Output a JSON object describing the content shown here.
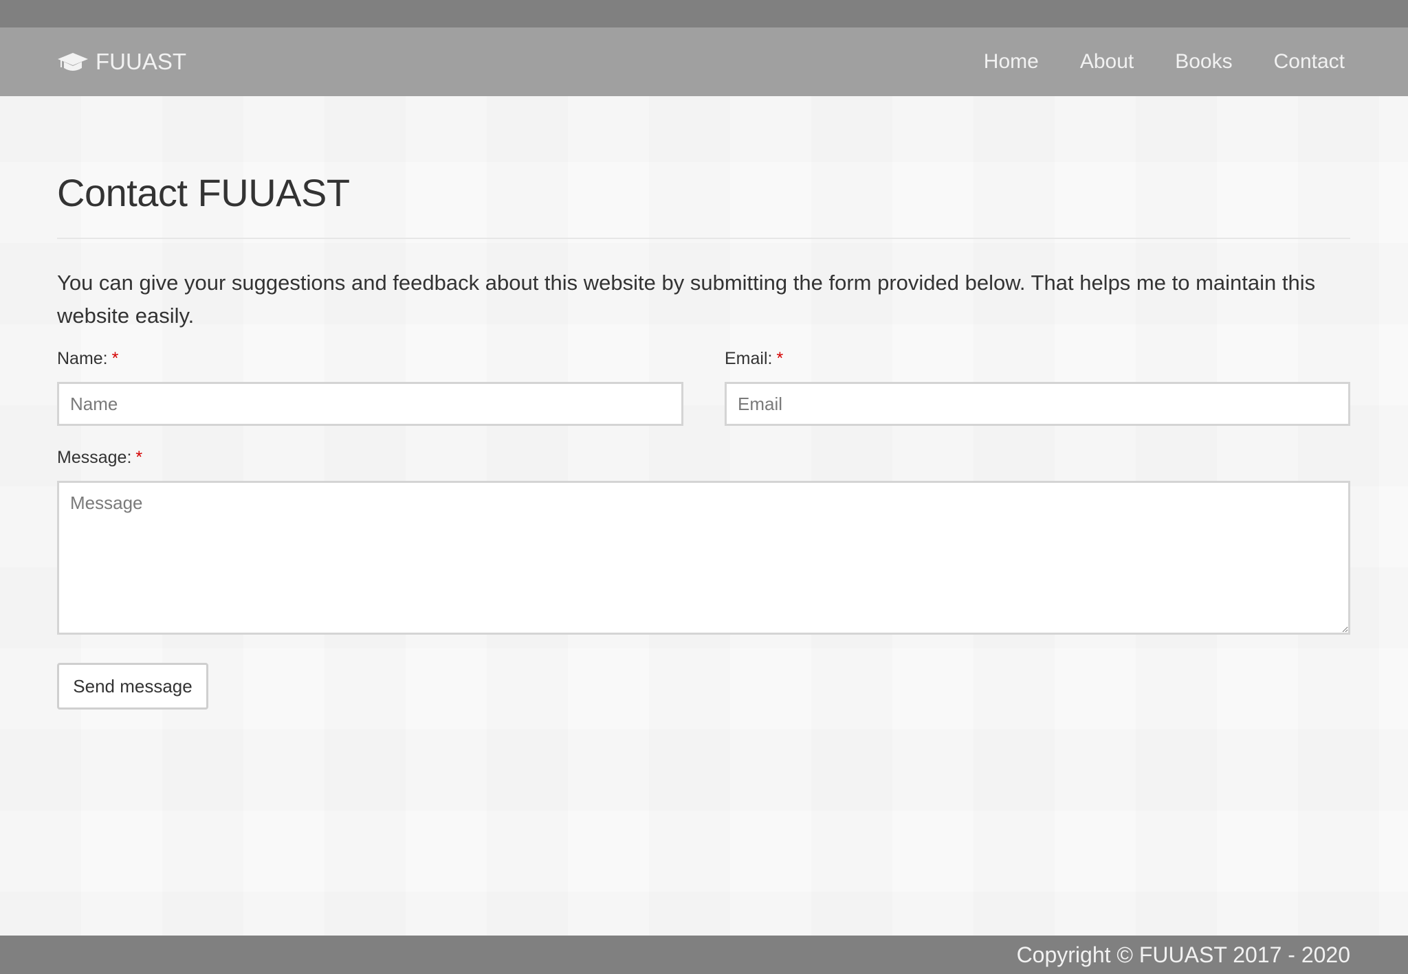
{
  "navbar": {
    "brand": "FUUAST",
    "brand_icon": "graduation-cap-icon",
    "links": [
      "Home",
      "About",
      "Books",
      "Contact"
    ]
  },
  "page": {
    "title": "Contact FUUAST",
    "intro": "You can give your suggestions and feedback about this website by submitting the form provided below. That helps me to maintain this website easily."
  },
  "form": {
    "name_label": "Name:",
    "email_label": "Email:",
    "message_label": "Message:",
    "required_marker": "*",
    "name_placeholder": "Name",
    "email_placeholder": "Email",
    "message_placeholder": "Message",
    "name_value": "",
    "email_value": "",
    "message_value": "",
    "submit_label": "Send message"
  },
  "footer": {
    "copyright": "Copyright © FUUAST 2017 - 2020"
  },
  "colors": {
    "top_strip": "#808080",
    "navbar_bg": "#a0a0a0",
    "footer_bg": "#808080",
    "required": "#d40000"
  }
}
